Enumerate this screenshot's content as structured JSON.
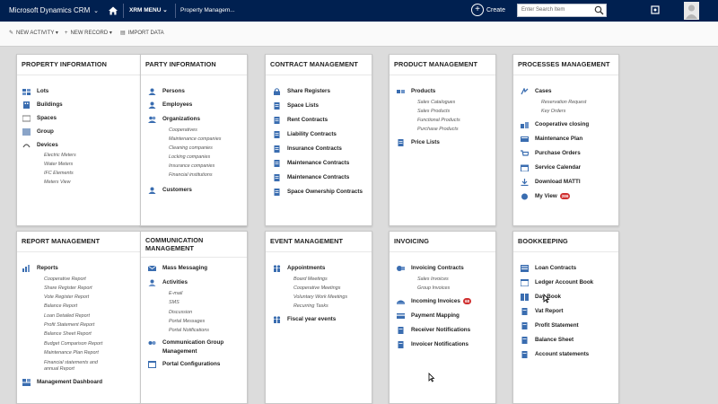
{
  "topbar": {
    "brand": "Microsoft Dynamics CRM",
    "menu": "XRM MENU",
    "breadcrumb": "Property Managem...",
    "create": "Create",
    "search_placeholder": "Enter Search Item"
  },
  "commands": {
    "new_activity": "NEW ACTIVITY",
    "new_record": "NEW RECORD",
    "import_data": "IMPORT DATA"
  },
  "tiles": {
    "property": {
      "title": "PROPERTY INFORMATION",
      "items": [
        "Lots",
        "Buildings",
        "Spaces",
        "Group",
        "Devices"
      ],
      "devices_sub": [
        "Electric Meters",
        "Water Meters",
        "IFC Elements",
        "Meters View"
      ]
    },
    "party": {
      "title": "PARTY INFORMATION",
      "items": [
        "Persons",
        "Employees",
        "Organizations",
        "Customers"
      ],
      "org_sub": [
        "Cooperatives",
        "Maintenance companies",
        "Cleaning companies",
        "Locking companies",
        "Insurance companies",
        "Financial institutions"
      ]
    },
    "contract": {
      "title": "CONTRACT MANAGEMENT",
      "items": [
        "Share Registers",
        "Space Lists",
        "Rent Contracts",
        "Liability Contracts",
        "Insurance Contracts",
        "Maintenance Contracts",
        "Maintenance Contracts",
        "Space Ownership Contracts"
      ]
    },
    "product": {
      "title": "PRODUCT MANAGEMENT",
      "items": [
        "Products",
        "Price Lists"
      ],
      "products_sub": [
        "Sales Catalogues",
        "Sales Products",
        "Functional Products",
        "Purchase Products"
      ]
    },
    "processes": {
      "title": "PROCESSES MANAGEMENT",
      "cases": "Cases",
      "cases_sub": [
        "Reservation Request",
        "Key Orders"
      ],
      "items": [
        "Cooperative closing",
        "Maintenance Plan",
        "Purchase Orders",
        "Service Calendar",
        "Download MATTI",
        "My View"
      ],
      "my_view_badge": "286"
    },
    "report": {
      "title": "REPORT MANAGEMENT",
      "reports": "Reports",
      "reports_sub": [
        "Cooperative Report",
        "Share Register Report",
        "Vote Register Report",
        "Balance Report",
        "Loan Detailed Report",
        "Profit Statement Report",
        "Balance Sheet Report",
        "Budget Comparison Report",
        "Maintenance Plan Report",
        "Financial statements and",
        "annual Report"
      ],
      "dashboard": "Management Dashboard"
    },
    "communication": {
      "title_line1": "COMMUNICATION",
      "title_line2": "MANAGEMENT",
      "mass": "Mass Messaging",
      "activities": "Activities",
      "activities_sub": [
        "E-mail",
        "SMS",
        "Discussion",
        "Portal Messages",
        "Portal Notifications"
      ],
      "group_line1": "Communication Group",
      "group_line2": "Management",
      "portal": "Portal Configurations"
    },
    "event": {
      "title": "EVENT MANAGEMENT",
      "appointments": "Appointments",
      "appointments_sub": [
        "Board Meetings",
        "Cooperative Meetings",
        "Voluntary Work Meetings",
        "Recurring Tasks"
      ],
      "fiscal": "Fiscal year events"
    },
    "invoicing": {
      "title": "INVOICING",
      "contracts": "Invoicing Contracts",
      "contracts_sub": [
        "Sales Invoices",
        "Group Invoices"
      ],
      "incoming": "Incoming Invoices",
      "incoming_badge": "68",
      "items": [
        "Payment Mapping",
        "Receiver Notifications",
        "Invoicer Notifications"
      ]
    },
    "bookkeeping": {
      "title": "BOOKKEEPING",
      "items": [
        "Loan Contracts",
        "Ledger Account Book",
        "Day Book",
        "Vat Report",
        "Profit Statement",
        "Balance Sheet",
        "Account statements"
      ]
    }
  },
  "colors": {
    "topbar": "#002050",
    "badge": "#d03030",
    "icon_blue": "#3a6db0"
  }
}
